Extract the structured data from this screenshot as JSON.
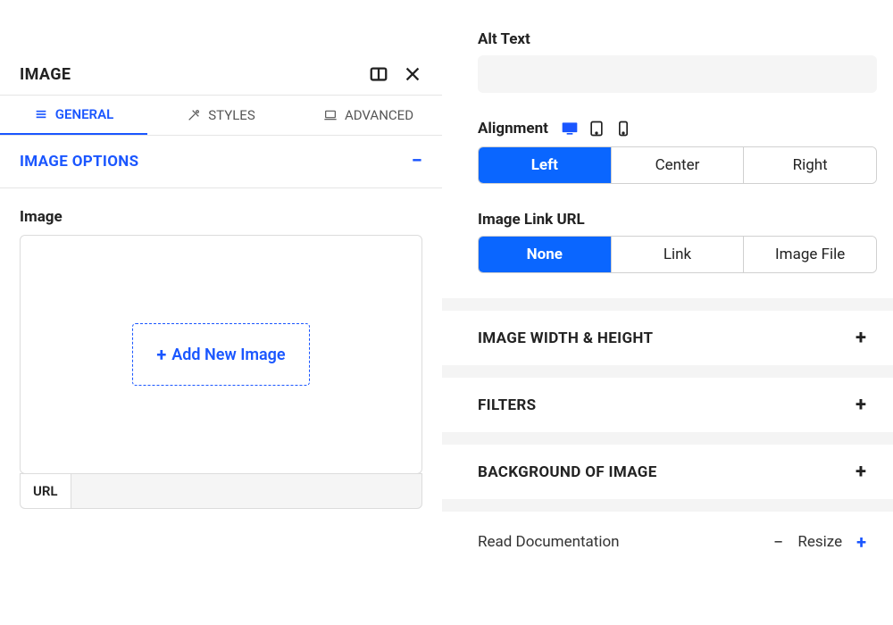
{
  "panel": {
    "title": "IMAGE"
  },
  "tabs": {
    "general": "GENERAL",
    "styles": "STYLES",
    "advanced": "ADVANCED"
  },
  "sections": {
    "image_options": "IMAGE OPTIONS"
  },
  "image_field": {
    "label": "Image",
    "add_button": "Add New Image",
    "url_label": "URL",
    "url_value": ""
  },
  "alt_text": {
    "label": "Alt Text",
    "value": ""
  },
  "alignment": {
    "label": "Alignment",
    "options": {
      "left": "Left",
      "center": "Center",
      "right": "Right"
    }
  },
  "image_link": {
    "label": "Image Link URL",
    "options": {
      "none": "None",
      "link": "Link",
      "file": "Image File"
    }
  },
  "accordions": {
    "width_height": "IMAGE WIDTH & HEIGHT",
    "filters": "FILTERS",
    "background": "BACKGROUND OF IMAGE"
  },
  "footer": {
    "read_doc": "Read Documentation",
    "resize": "Resize"
  }
}
